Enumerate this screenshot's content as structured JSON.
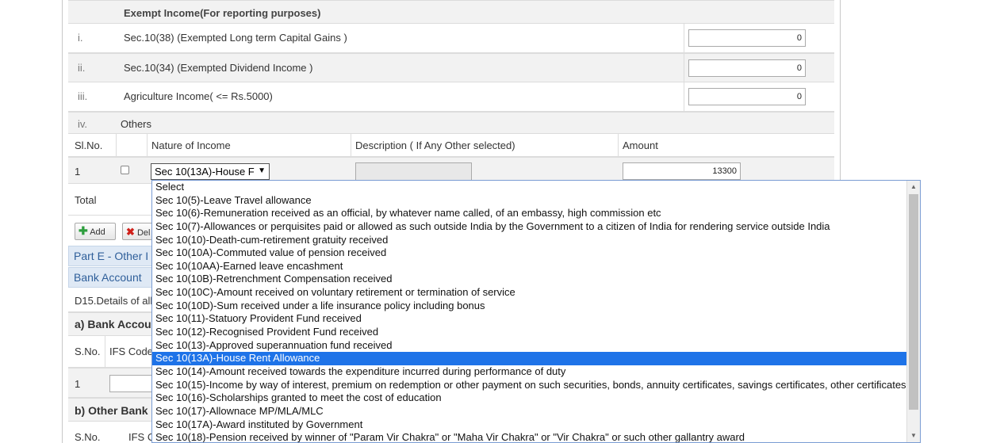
{
  "exempt": {
    "header": "Exempt Income(For reporting purposes)",
    "rows": [
      {
        "num": "i.",
        "label": "Sec.10(38) (Exempted Long term Capital Gains )",
        "value": "0"
      },
      {
        "num": "ii.",
        "label": "Sec.10(34) (Exempted Dividend Income )",
        "value": "0"
      },
      {
        "num": "iii.",
        "label": "Agriculture Income( <= Rs.5000)",
        "value": "0"
      }
    ],
    "others": {
      "num": "iv.",
      "label": "Others"
    }
  },
  "others_table": {
    "headers": {
      "slno": "Sl.No.",
      "nature": "Nature of Income",
      "description": "Description ( If Any Other selected)",
      "amount": "Amount"
    },
    "row": {
      "slno": "1",
      "select_value": "Sec 10(13A)-House F",
      "amount": "13300"
    },
    "total_label": "Total"
  },
  "buttons": {
    "add": "Add",
    "delete": "Del"
  },
  "sections": {
    "part_e": "Part E - Other I",
    "bank_account": "Bank Account",
    "d15": "D15.Details of all",
    "a_bank": "a) Bank Accou",
    "sno": "S.No.",
    "ifs_code": "IFS Code",
    "row1": "1",
    "b_other": "b) Other Bank",
    "sno2": "S.No.",
    "ifs2": "IFS C"
  },
  "dropdown": {
    "selected_index": 13,
    "options": [
      "Select",
      "Sec 10(5)-Leave Travel allowance",
      "Sec 10(6)-Remuneration received as an official, by whatever name called, of an embassy, high commission etc",
      "Sec 10(7)-Allowances or perquisites paid or allowed as such outside India by the Government to a citizen of India for rendering service outside India",
      "Sec 10(10)-Death-cum-retirement gratuity received",
      "Sec 10(10A)-Commuted value of pension received",
      "Sec 10(10AA)-Earned leave encashment",
      "Sec 10(10B)-Retrenchment Compensation received",
      "Sec 10(10C)-Amount received on voluntary retirement or termination of service",
      "Sec 10(10D)-Sum received under a life insurance policy including bonus",
      "Sec 10(11)-Statuory Provident Fund received",
      "Sec 10(12)-Recognised Provident Fund received",
      "Sec 10(13)-Approved superannuation fund received",
      "Sec 10(13A)-House Rent Allowance",
      "Sec 10(14)-Amount received towards the expenditure incurred during performance of duty",
      "Sec 10(15)-Income by way of interest, premium on redemption or other payment on such securities, bonds, annuity certificates, savings certificates, other certificates",
      "Sec 10(16)-Scholarships granted to meet the cost of education",
      "Sec 10(17)-Allownace MP/MLA/MLC",
      "Sec 10(17A)-Award instituted by Government",
      "Sec 10(18)-Pension received by winner of \"Param Vir Chakra\" or \"Maha Vir Chakra\" or \"Vir Chakra\" or such other gallantry award"
    ]
  },
  "colors": {
    "highlight": "#1e73e8",
    "section_text": "#2f5f9a",
    "add_icon": "#2e9e3e",
    "delete_icon": "#d0201a"
  }
}
